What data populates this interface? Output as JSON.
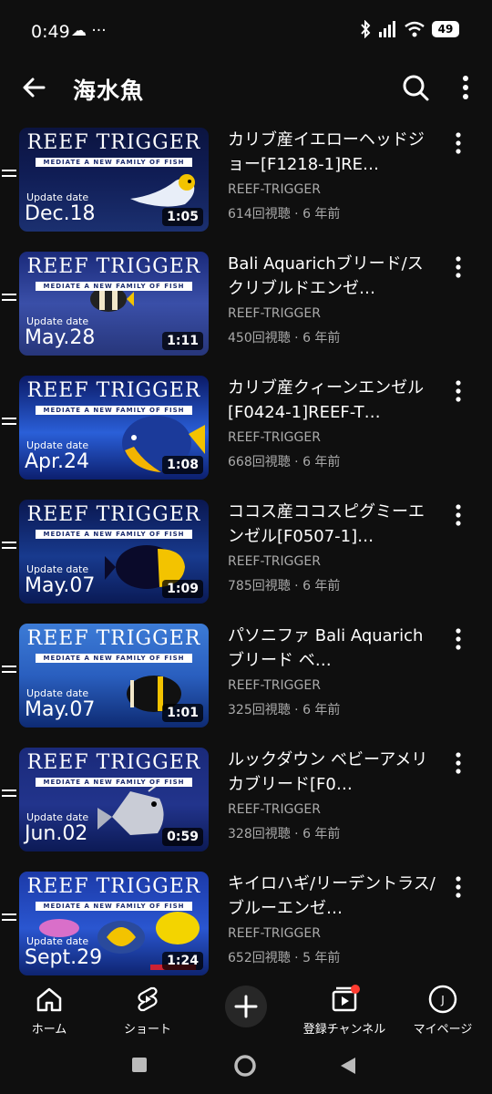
{
  "status": {
    "time": "0:49",
    "icons": "☁ ···",
    "battery": "49"
  },
  "topbar": {
    "title": "海水魚"
  },
  "videos": [
    {
      "brand": "REEF TRIGGER",
      "sub": "MEDIATE A NEW FAMILY OF FISH",
      "update_label": "Update date",
      "date": "Dec.18",
      "duration": "1:05",
      "title": "カリブ産イエローヘッドジョー[F1218-1]RE…",
      "channel": "REEF-TRIGGER",
      "stats": "614回視聴 · 6 年前"
    },
    {
      "brand": "REEF TRIGGER",
      "sub": "MEDIATE A NEW FAMILY OF FISH",
      "update_label": "Update date",
      "date": "May.28",
      "duration": "1:11",
      "title": "Bali Aquarichブリード/スクリブルドエンゼ…",
      "channel": "REEF-TRIGGER",
      "stats": "450回視聴 · 6 年前"
    },
    {
      "brand": "REEF TRIGGER",
      "sub": "MEDIATE A NEW FAMILY OF FISH",
      "update_label": "Update date",
      "date": "Apr.24",
      "duration": "1:08",
      "title": "カリブ産クィーンエンゼル[F0424-1]REEF-T…",
      "channel": "REEF-TRIGGER",
      "stats": "668回視聴 · 6 年前"
    },
    {
      "brand": "REEF TRIGGER",
      "sub": "MEDIATE A NEW FAMILY OF FISH",
      "update_label": "Update date",
      "date": "May.07",
      "duration": "1:09",
      "title": "ココス産ココスピグミーエンゼル[F0507-1]…",
      "channel": "REEF-TRIGGER",
      "stats": "785回視聴 · 6 年前"
    },
    {
      "brand": "REEF TRIGGER",
      "sub": "MEDIATE A NEW FAMILY OF FISH",
      "update_label": "Update date",
      "date": "May.07",
      "duration": "1:01",
      "title": "パソニファ Bali Aquarichブリード ベ…",
      "channel": "REEF-TRIGGER",
      "stats": "325回視聴 · 6 年前"
    },
    {
      "brand": "REEF TRIGGER",
      "sub": "MEDIATE A NEW FAMILY OF FISH",
      "update_label": "Update date",
      "date": "Jun.02",
      "duration": "0:59",
      "title": "ルックダウン ベビーアメリカブリード[F0…",
      "channel": "REEF-TRIGGER",
      "stats": "328回視聴 · 6 年前"
    },
    {
      "brand": "REEF TRIGGER",
      "sub": "MEDIATE A NEW FAMILY OF FISH",
      "update_label": "Update date",
      "date": "Sept.29",
      "duration": "1:24",
      "title": "キイロハギ/リーデントラス/ブルーエンゼ…",
      "channel": "REEF-TRIGGER",
      "stats": "652回視聴 · 5 年前"
    }
  ],
  "nav": {
    "home": "ホーム",
    "shorts": "ショート",
    "subscriptions": "登録チャンネル",
    "you": "マイページ"
  },
  "colors": {
    "background": "#0f0f0f",
    "secondary_text": "#aaaaaa",
    "notification_dot": "#ff3b30",
    "thumb_blue": "#1b2f86"
  }
}
